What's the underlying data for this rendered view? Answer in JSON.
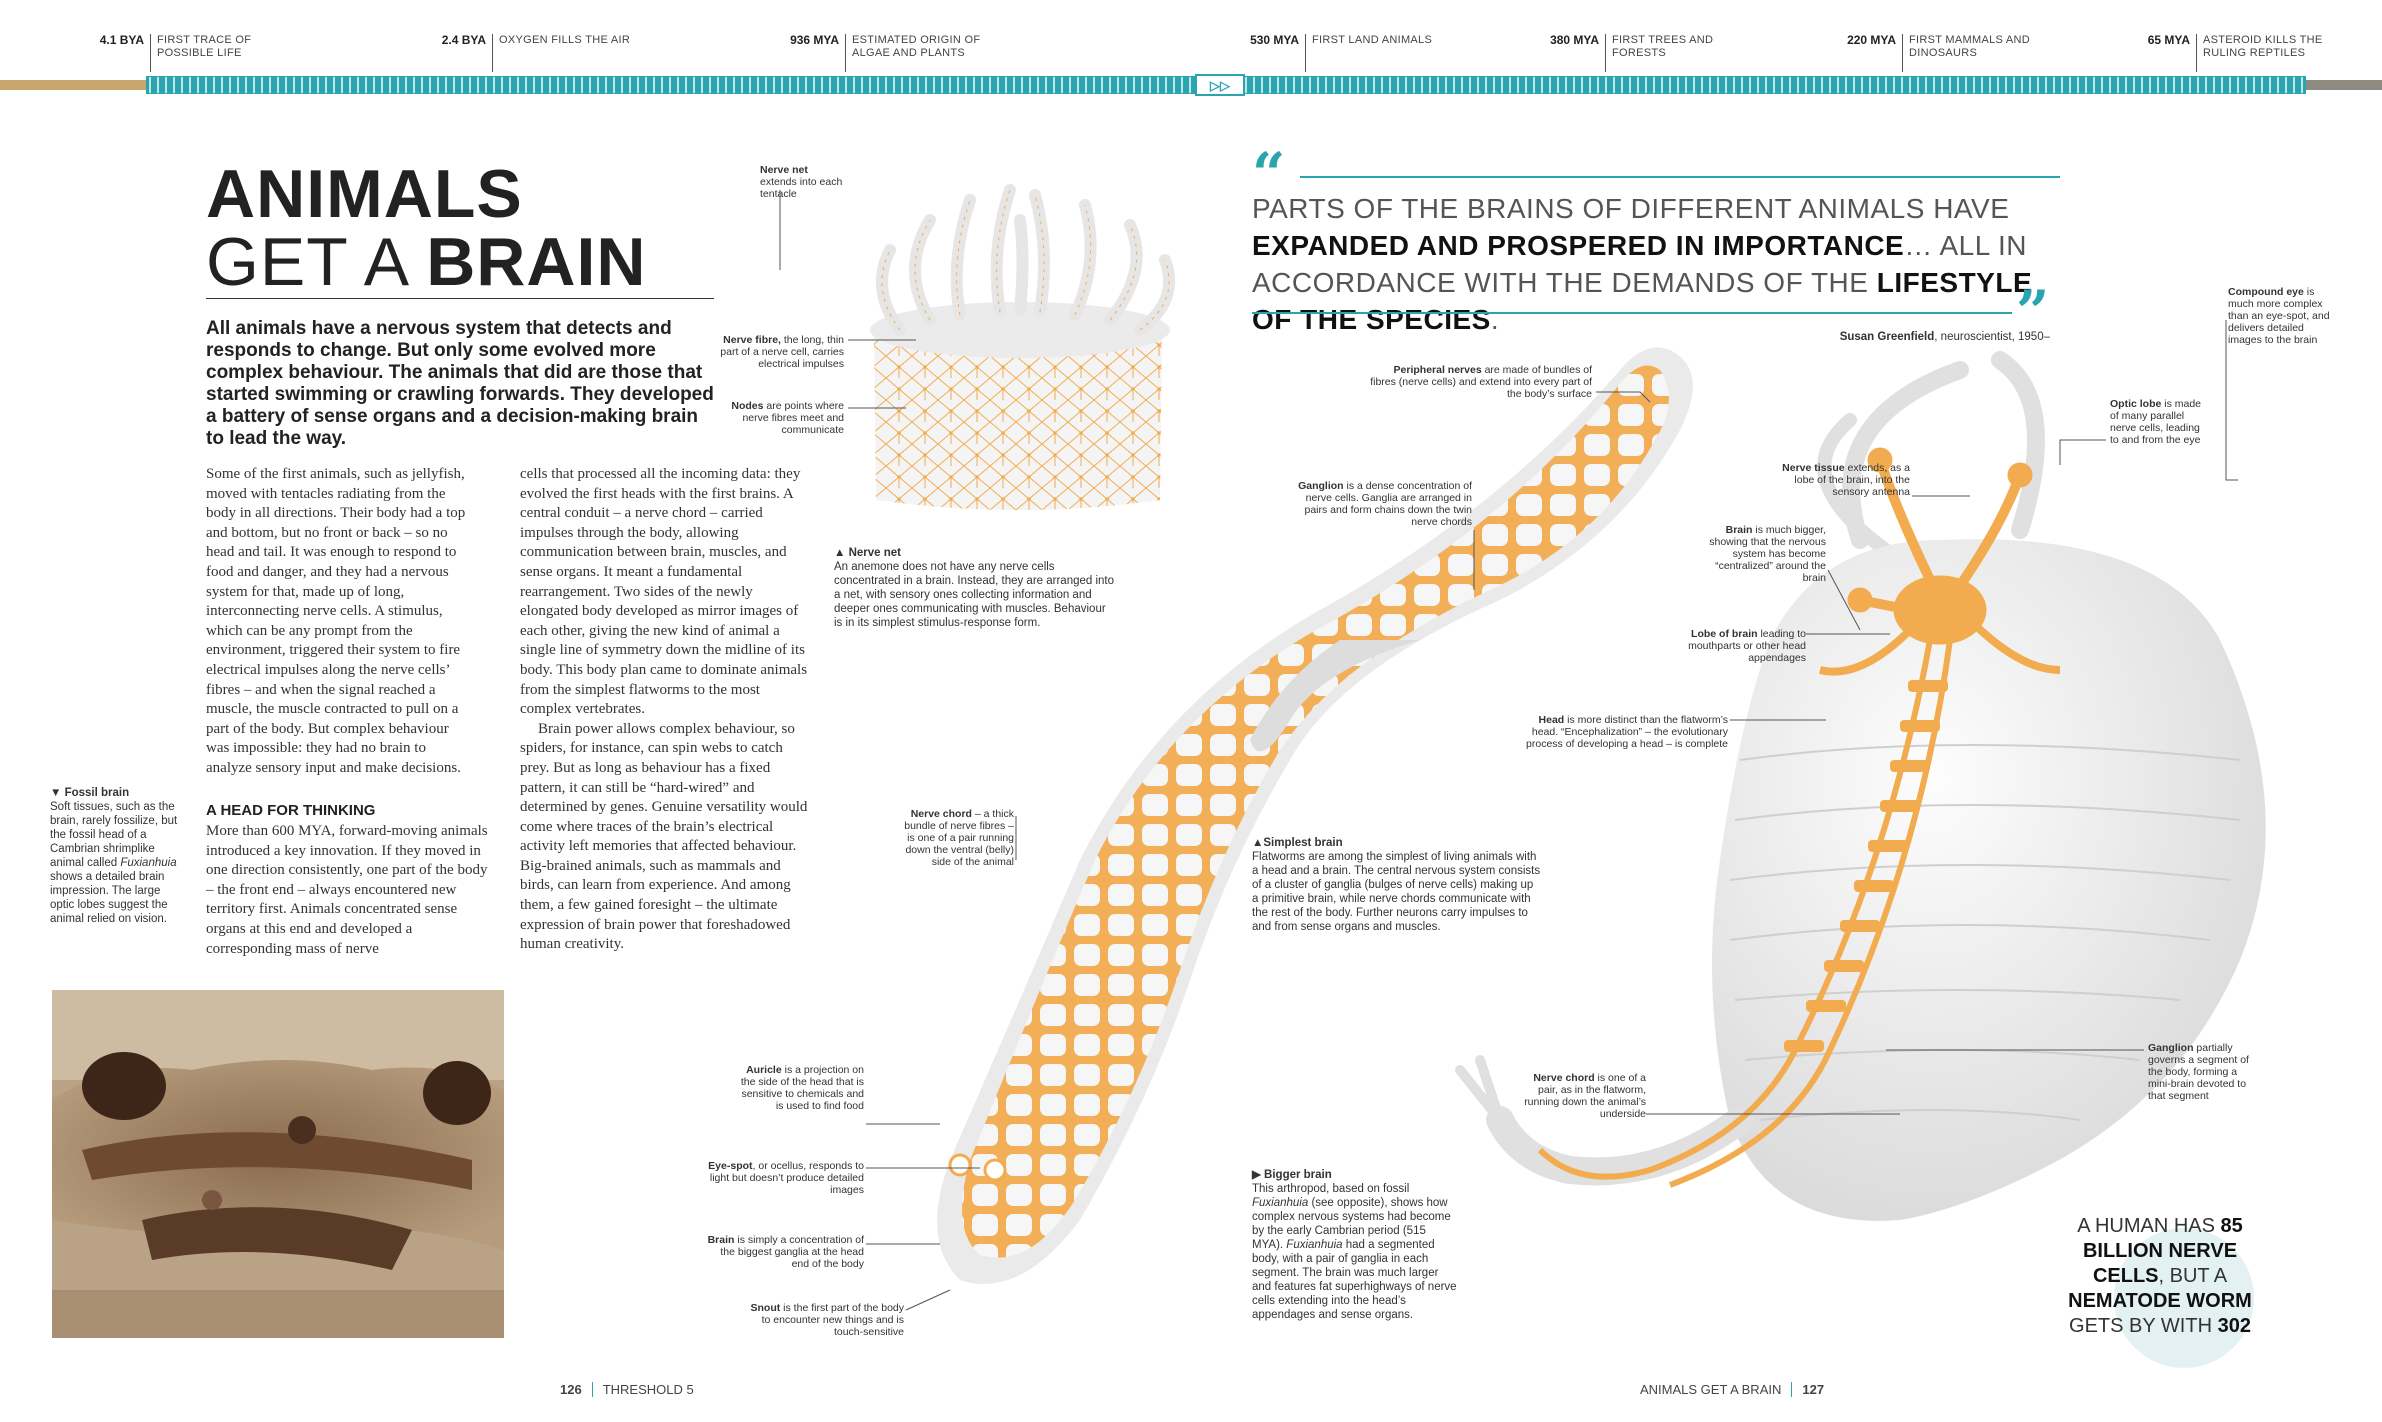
{
  "timeline": [
    {
      "date": "4.1 BYA",
      "text": "FIRST TRACE OF POSSIBLE LIFE"
    },
    {
      "date": "2.4 BYA",
      "text": "OXYGEN FILLS THE AIR"
    },
    {
      "date": "936 MYA",
      "text": "ESTIMATED ORIGIN OF ALGAE AND PLANTS"
    },
    {
      "date": "530 MYA",
      "text": "FIRST LAND ANIMALS"
    },
    {
      "date": "380 MYA",
      "text": "FIRST TREES AND FORESTS"
    },
    {
      "date": "220 MYA",
      "text": "FIRST MAMMALS AND DINOSAURS"
    },
    {
      "date": "65 MYA",
      "text": "ASTEROID KILLS THE RULING REPTILES"
    }
  ],
  "colors": {
    "teal": "#2aa5b0",
    "orange": "#f2ac4f",
    "gold": "#c9a66b"
  },
  "title": {
    "line1": "ANIMALS",
    "line2_pre": "GET A ",
    "line2_bold": "BRAIN"
  },
  "intro": "All animals have a nervous system that detects and responds to change. But only some evolved more complex behaviour. The animals that did are those that started swimming or crawling forwards. They developed a battery of sense organs and a decision-making brain to lead the way.",
  "col1": "Some of the first animals, such as jellyfish, moved with tentacles radiating from the body in all directions. Their body had a top and bottom, but no front or back – so no head and tail. It was enough to respond to food and danger, and they had a nervous system for that, made up of long, interconnecting nerve cells. A stimulus, which can be any prompt from the environment, triggered their system to fire electrical impulses along the nerve cells’ fibres – and when the signal reached a muscle, the muscle contracted to pull on a part of the body. But complex behaviour was impossible: they had no brain to analyze sensory input and make decisions.",
  "head_thinking": "A HEAD FOR THINKING",
  "col1b": "More than 600 MYA, forward-moving animals introduced a key innovation. If they moved in one direction consistently, one part of the body – the front end – always encountered new territory first. Animals concentrated sense organs at this end and developed a corresponding mass of nerve",
  "col2a": "cells that processed all the incoming data: they evolved the first heads with the first brains. A central conduit – a nerve chord – carried impulses through the body, allowing communication between brain, muscles, and sense organs. It meant a fundamental rearrangement. Two sides of the newly elongated body developed as mirror images of each other, giving the new kind of animal a single line of symmetry down the midline of its body. This body plan came to dominate animals from the simplest flatworms to the most complex vertebrates.",
  "col2b": "Brain power allows complex behaviour, so spiders, for instance, can spin webs to catch prey. But as long as behaviour has a fixed pattern, it can still be “hard-wired” and determined by genes. Genuine versatility would come where traces of the brain’s electrical activity left memories that affected behaviour. Big-brained animals, such as mammals and birds, can learn from experience. And among them, a few gained foresight – the ultimate expression of brain power that foreshadowed human creativity.",
  "fossil_caption": {
    "title": "▼ Fossil brain",
    "text_a": "Soft tissues, such as the brain, rarely fossilize, but the fossil head of a Cambrian shrimplike animal called ",
    "italic": "Fuxianhuia",
    "text_b": " shows a detailed brain impression. The large optic lobes suggest the animal relied on vision."
  },
  "anemone": {
    "nervenet_label": {
      "bold": "Nerve net",
      "text": "extends into each tentacle"
    },
    "fibre_label": {
      "bold": "Nerve fibre,",
      "text": " the long, thin part of a nerve cell, carries electrical impulses"
    },
    "nodes_label": {
      "bold": "Nodes",
      "text": " are points where nerve fibres meet and communicate"
    },
    "caption_title": "▲ Nerve net",
    "caption": "An anemone does not have any nerve cells concentrated in a brain. Instead, they are arranged into a net, with sensory ones collecting information and deeper ones communicating with muscles. Behaviour is in its simplest stimulus-response form."
  },
  "quote": {
    "a": "PARTS OF THE BRAINS OF DIFFERENT ANIMALS HAVE ",
    "b": "EXPANDED AND PROSPERED IN IMPORTANCE",
    "c": "… ALL IN ACCORDANCE WITH THE DEMANDS OF THE ",
    "d": "LIFESTYLE OF THE SPECIES",
    "e": ".",
    "author": "Susan Greenfield",
    "author_rest": ", neuroscientist, 1950–"
  },
  "flatworm": {
    "peripheral": {
      "bold": "Peripheral nerves",
      "text": " are made of bundles of fibres (nerve cells) and extend into every part of the body’s surface"
    },
    "ganglion": {
      "bold": "Ganglion",
      "text": " is a dense concentration of nerve cells. Ganglia are arranged in pairs and form chains down the twin nerve chords"
    },
    "chord": {
      "bold": "Nerve chord",
      "text": " – a thick bundle of nerve fibres – is one of a pair running down the ventral (belly) side of the animal"
    },
    "auricle": {
      "bold": "Auricle",
      "text": " is a projection on the side of the head that is sensitive to chemicals and is used to find food"
    },
    "eyespot": {
      "bold": "Eye-spot",
      "text": ", or ocellus, responds to light but doesn’t produce detailed images"
    },
    "brain": {
      "bold": "Brain",
      "text": " is simply a concentration of the biggest ganglia at the head end of the body"
    },
    "snout": {
      "bold": "Snout",
      "text": " is the first part of the body to encounter new things and is touch-sensitive"
    },
    "caption_title": "▲Simplest brain",
    "caption": "Flatworms are among the simplest of living animals with a head and a brain. The central nervous system consists of a cluster of ganglia (bulges of nerve cells) making up a primitive brain, while nerve chords communicate with the rest of the body. Further neurons carry impulses to and from sense organs and muscles."
  },
  "arthropod": {
    "compound": {
      "bold": "Compound eye",
      "text": " is much more complex than an eye-spot, and delivers detailed images to the brain"
    },
    "optic": {
      "bold": "Optic lobe",
      "text": " is made of many parallel nerve cells, leading to and from the eye"
    },
    "tissue": {
      "bold": "Nerve tissue",
      "text": " extends, as a lobe of the brain, into the sensory antenna"
    },
    "brainbig": {
      "bold": "Brain",
      "text": " is much bigger, showing that the nervous system has become “centralized” around the brain"
    },
    "lobe": {
      "bold": "Lobe of brain",
      "text": " leading to mouthparts or other head appendages"
    },
    "head": {
      "bold": "Head",
      "text": " is more distinct than the flatworm’s head. “Encephalization” – the evolutionary process of developing a head – is complete"
    },
    "ganglion": {
      "bold": "Ganglion",
      "text": " partially governs a segment of the body, forming a mini-brain devoted to that segment"
    },
    "chord": {
      "bold": "Nerve chord",
      "text": " is one of a pair, as in the flatworm, running down the animal’s underside"
    },
    "caption_title": "▶ Bigger brain",
    "caption_a": "This arthropod, based on fossil ",
    "caption_it": "Fuxianhuia",
    "caption_b": " (see opposite), shows how complex nervous systems had become by the early Cambrian period (515 MYA). ",
    "caption_it2": "Fuxianhuia",
    "caption_c": " had a segmented body, with a pair of ganglia in each segment. The brain was much larger and features fat superhighways of nerve cells extending into the head’s appendages and sense organs."
  },
  "stat": {
    "a": "A HUMAN HAS ",
    "b": "85 BILLION NERVE CELLS",
    "c": ", BUT A ",
    "d": "NEMATODE WORM",
    "e": " GETS BY WITH ",
    "f": "302"
  },
  "folio": {
    "left_num": "126",
    "left_text": "THRESHOLD 5",
    "right_text": "ANIMALS GET A BRAIN",
    "right_num": "127"
  }
}
